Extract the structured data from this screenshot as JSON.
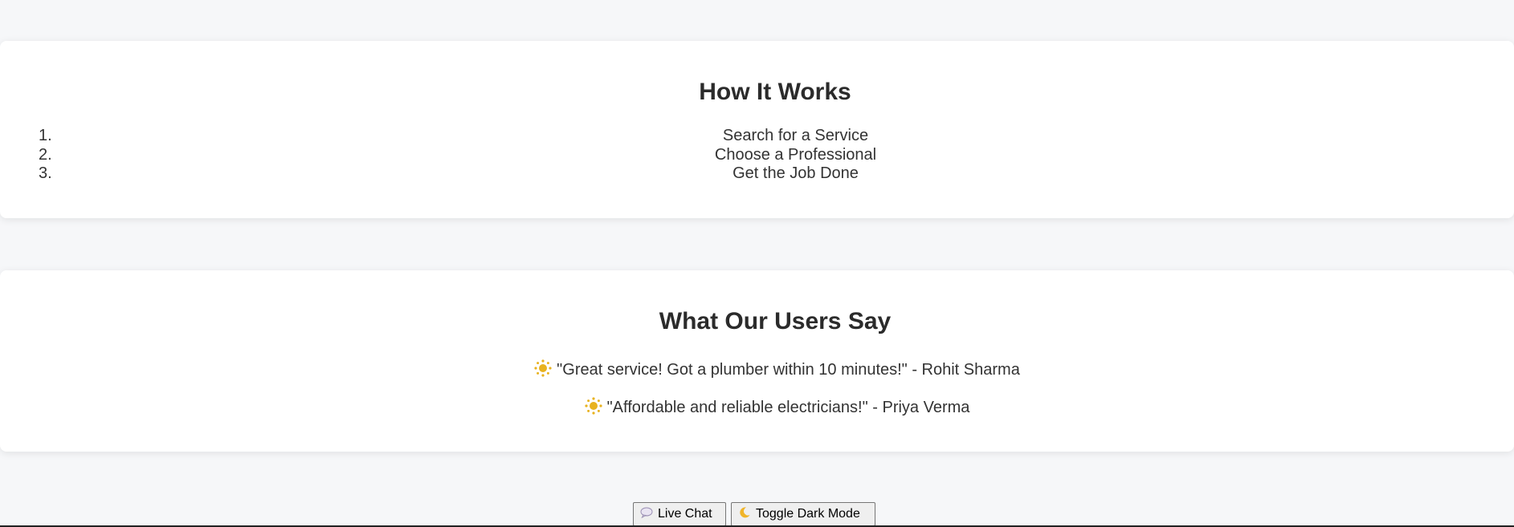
{
  "how_it_works": {
    "title": "How It Works",
    "steps": [
      {
        "number": "1.",
        "label": "Search for a Service"
      },
      {
        "number": "2.",
        "label": "Choose a Professional"
      },
      {
        "number": "3.",
        "label": "Get the Job Done"
      }
    ]
  },
  "testimonials": {
    "title": "What Our Users Say",
    "items": [
      {
        "icon": "sun-icon",
        "text": "\"Great service! Got a plumber within 10 minutes!\" - Rohit Sharma"
      },
      {
        "icon": "sun-icon",
        "text": "\"Affordable and reliable electricians!\" - Priya Verma"
      }
    ]
  },
  "actions": {
    "live_chat_label": "Live Chat",
    "live_chat_icon": "chat-bubble-icon",
    "dark_mode_label": "Toggle Dark Mode",
    "dark_mode_icon": "moon-icon"
  },
  "colors": {
    "background": "#f6f7f9",
    "card": "#ffffff",
    "text": "#333333",
    "sun": "#e8b21f"
  }
}
